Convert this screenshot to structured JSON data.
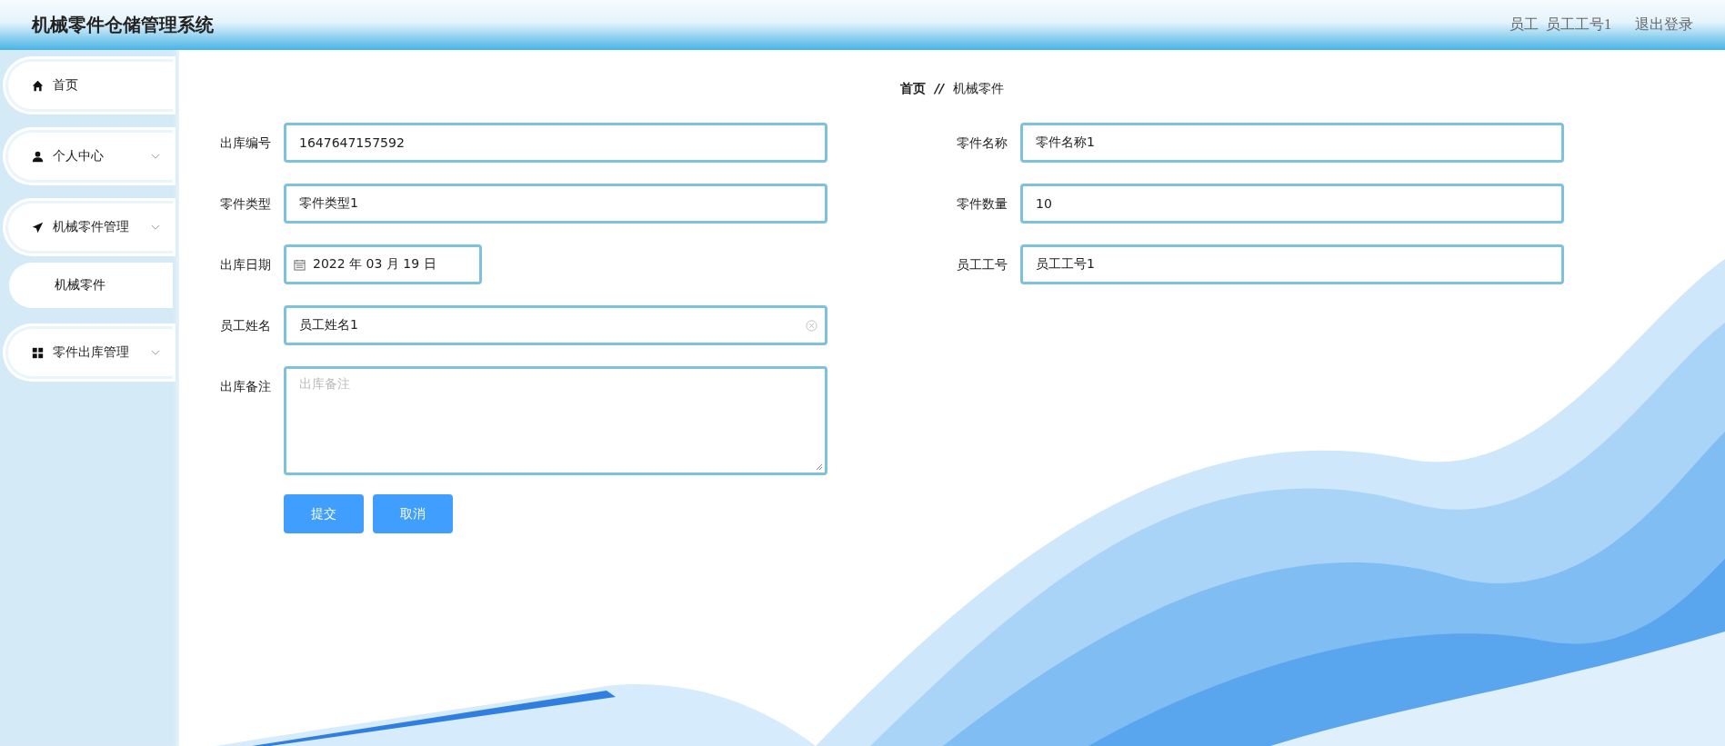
{
  "header": {
    "title": "机械零件仓储管理系统",
    "role": "员工",
    "user": "员工工号1",
    "logout": "退出登录"
  },
  "sidebar": {
    "items": [
      {
        "kind": "link",
        "label": "首页"
      },
      {
        "kind": "group",
        "label": "个人中心"
      },
      {
        "kind": "group",
        "label": "机械零件管理",
        "children": [
          {
            "label": "机械零件",
            "selected": true
          }
        ]
      },
      {
        "kind": "group",
        "label": "零件出库管理"
      }
    ]
  },
  "breadcrumb": {
    "items": [
      "首页",
      "机械零件"
    ],
    "separator": "//"
  },
  "form": {
    "left_fields": [
      {
        "kind": "text",
        "label": "出库编号",
        "value": "1647647157592",
        "clear": false
      },
      {
        "kind": "text",
        "label": "零件类型",
        "value": "零件类型1",
        "clear": false
      },
      {
        "kind": "date",
        "label": "出库日期",
        "value": "2022 年 03 月 19 日",
        "clear": false
      },
      {
        "kind": "text",
        "label": "员工姓名",
        "value": "员工姓名1",
        "clear": true
      },
      {
        "kind": "textarea",
        "label": "出库备注",
        "placeholder": "出库备注",
        "clear": false
      }
    ],
    "right_fields": [
      {
        "kind": "text",
        "label": "零件名称",
        "value": "零件名称1",
        "clear": false
      },
      {
        "kind": "text",
        "label": "零件数量",
        "value": "10",
        "clear": false
      },
      {
        "kind": "text",
        "label": "员工工号",
        "value": "员工工号1",
        "clear": false
      }
    ],
    "buttons": [
      "提交",
      "取消"
    ]
  }
}
